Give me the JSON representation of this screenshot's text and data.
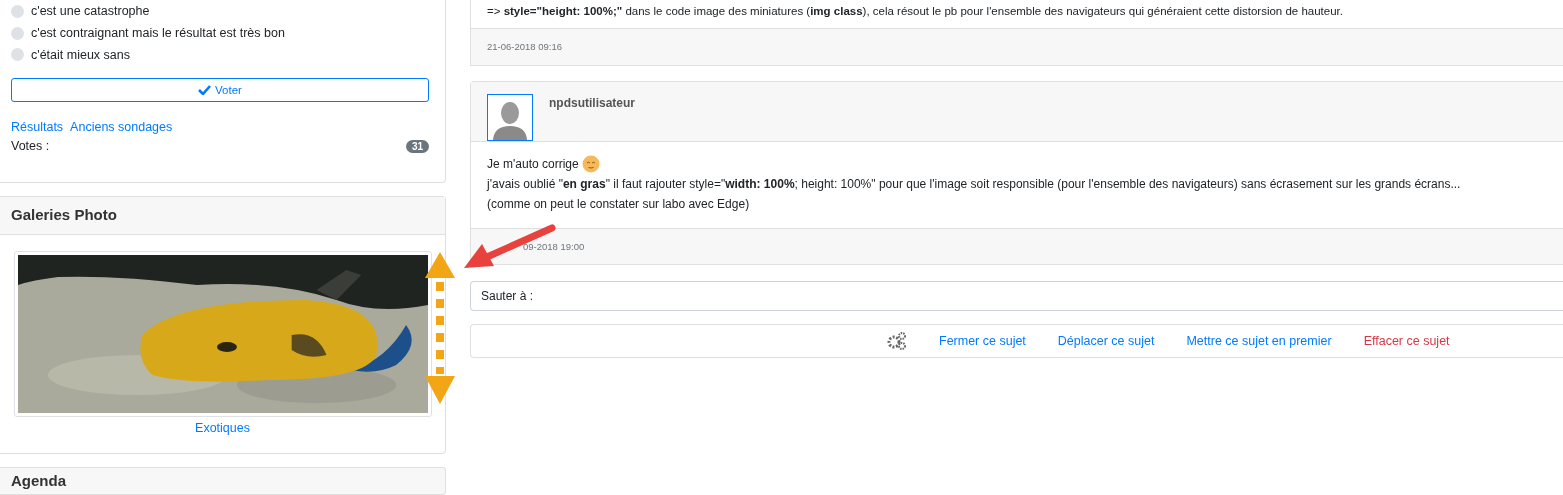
{
  "poll": {
    "options": [
      {
        "label": "c'est une catastrophe",
        "selected": false
      },
      {
        "label": "c'est contraignant mais le résultat est très bon",
        "selected": false
      },
      {
        "label": "c'était mieux sans",
        "selected": false
      }
    ],
    "vote_button": "Voter",
    "links": [
      "Résultats",
      "Anciens sondages"
    ],
    "votes_label": "Votes :",
    "votes_count": "31"
  },
  "gallery": {
    "title": "Galeries Photo",
    "caption": "Exotiques"
  },
  "agenda": {
    "title": "Agenda"
  },
  "previous_post": {
    "text": "=> **style=\"height: 100%;\"** dans le code image des miniatures (**img class**), cela résout le pb pour l'ensemble des navigateurs qui généraient cette distorsion de hauteur.",
    "date": "21-06-2018 09:16"
  },
  "post": {
    "author": "npdsutilisateur",
    "lines": [
      "Je m'auto corrige",
      "j'avais oublié \"**en gras**\" il faut rajouter style=\"**width: 100%**; height: 100%\" pour que l'image soit responsible (pour l'ensemble des navigateurs) sans écrasement sur les grands écrans...",
      "(comme on peut le constater sur labo avec Edge)"
    ],
    "date": "09-2018 19:00"
  },
  "jump": {
    "label": "Sauter à :"
  },
  "actions": [
    {
      "label": "Fermer ce sujet",
      "kind": "normal"
    },
    {
      "label": "Déplacer ce sujet",
      "kind": "normal"
    },
    {
      "label": "Mettre ce sujet en premier",
      "kind": "normal"
    },
    {
      "label": "Effacer ce sujet",
      "kind": "danger"
    }
  ]
}
